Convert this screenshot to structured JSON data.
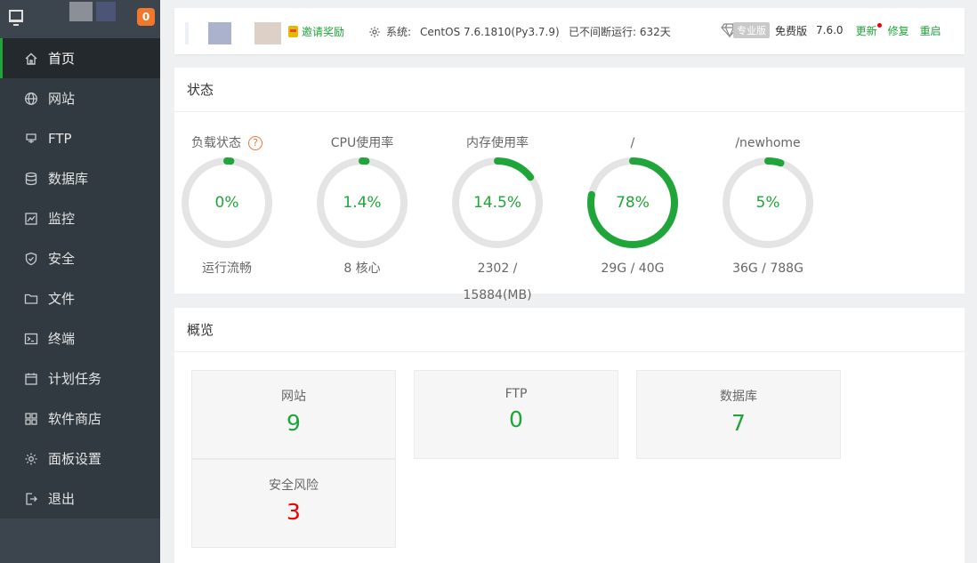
{
  "sidebar": {
    "badge": "0",
    "items": [
      {
        "label": "首页",
        "icon": "home-icon"
      },
      {
        "label": "网站",
        "icon": "globe-icon"
      },
      {
        "label": "FTP",
        "icon": "ftp-icon"
      },
      {
        "label": "数据库",
        "icon": "database-icon"
      },
      {
        "label": "监控",
        "icon": "monitor-icon"
      },
      {
        "label": "安全",
        "icon": "shield-icon"
      },
      {
        "label": "文件",
        "icon": "folder-icon"
      },
      {
        "label": "终端",
        "icon": "terminal-icon"
      },
      {
        "label": "计划任务",
        "icon": "calendar-icon"
      },
      {
        "label": "软件商店",
        "icon": "grid-icon"
      },
      {
        "label": "面板设置",
        "icon": "gear-icon"
      },
      {
        "label": "退出",
        "icon": "logout-icon"
      }
    ]
  },
  "topbar": {
    "invite": "邀请奖励",
    "system_label": "系统:",
    "system_value": "CentOS 7.6.1810(Py3.7.9)",
    "uptime": "已不间断运行: 632天",
    "pro_badge": "专业版",
    "free_edition": "免费版",
    "version": "7.6.0",
    "update": "更新",
    "repair": "修复",
    "restart": "重启"
  },
  "status": {
    "title": "状态",
    "gauges": [
      {
        "label": "负载状态",
        "value": "0%",
        "percent": 0,
        "sub": "运行流畅"
      },
      {
        "label": "CPU使用率",
        "value": "1.4%",
        "percent": 1.4,
        "sub": "8 核心"
      },
      {
        "label": "内存使用率",
        "value": "14.5%",
        "percent": 14.5,
        "sub": "2302 / 15884(MB)"
      },
      {
        "label": "/",
        "value": "78%",
        "percent": 78,
        "sub": "29G / 40G"
      },
      {
        "label": "/newhome",
        "value": "5%",
        "percent": 5,
        "sub": "36G / 788G"
      }
    ]
  },
  "overview": {
    "title": "概览",
    "cards": [
      {
        "label": "网站",
        "value": "9"
      },
      {
        "label": "FTP",
        "value": "0"
      },
      {
        "label": "数据库",
        "value": "7"
      },
      {
        "label": "安全风险",
        "value": "3"
      }
    ]
  },
  "colors": {
    "accent": "#20a53a",
    "danger": "#ee0000",
    "sidebar": "#313a40"
  }
}
